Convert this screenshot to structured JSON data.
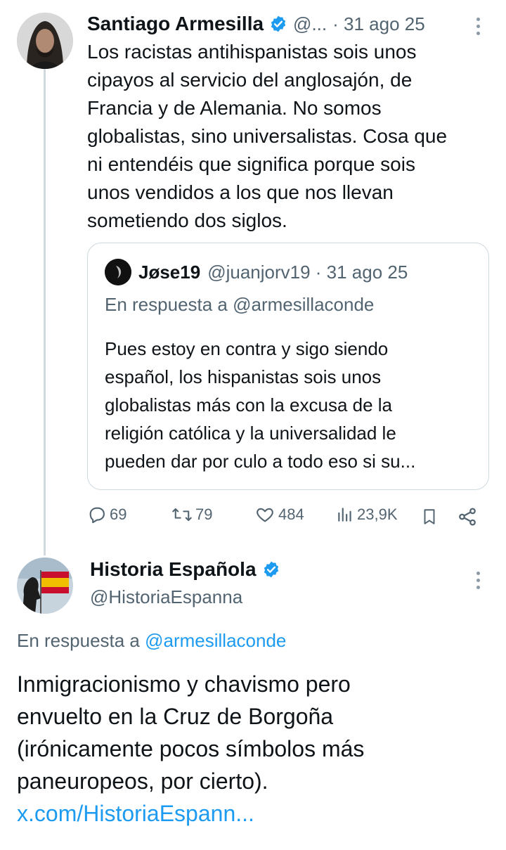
{
  "colors": {
    "accent": "#1d9bf0",
    "muted": "#536471",
    "text": "#0f1419",
    "border": "#cfd9de"
  },
  "tweet1": {
    "author_name": "Santiago Armesilla",
    "handle": "@...",
    "time": "· 31 ago 25",
    "lines": [
      "Los racistas antihispanistas sois unos",
      "cipayos al servicio del anglosajón, de",
      "Francia y de Alemania. No somos",
      "globalistas, sino universalistas. Cosa que",
      "ni entendéis que significa porque sois",
      "unos vendidos a los que nos llevan",
      "sometiendo dos siglos."
    ],
    "quote": {
      "author_name": "Jøse19",
      "handle_time": "@juanjorv19 · 31 ago 25",
      "reply_to": "En respuesta a @armesillaconde",
      "lines": [
        "Pues estoy en contra y sigo siendo",
        "español, los hispanistas sois unos",
        "globalistas más con la excusa de la",
        "religión católica y la universalidad le",
        "pueden dar por culo a todo eso si su..."
      ]
    },
    "actions": {
      "replies": "69",
      "retweets": "79",
      "likes": "484",
      "views": "23,9K"
    }
  },
  "tweet2": {
    "author_name": "Historia Española",
    "handle": "@HistoriaEspanna",
    "reply_prefix": "En respuesta a ",
    "reply_handle": "@armesillaconde",
    "lines": [
      "Inmigracionismo y chavismo pero",
      "envuelto en la Cruz de Borgoña",
      "(irónicamente pocos símbolos más",
      "paneuropeos, por cierto)."
    ],
    "link": "x.com/HistoriaEspann..."
  }
}
